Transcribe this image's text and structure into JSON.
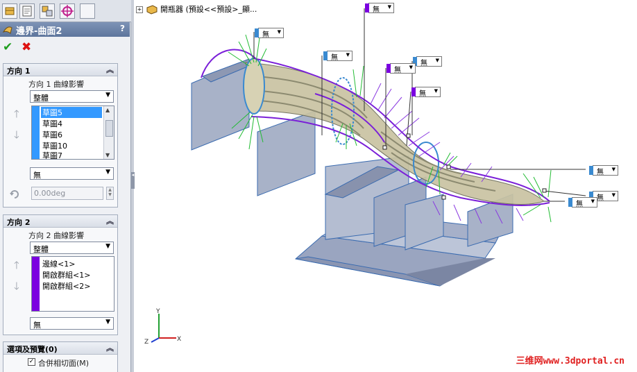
{
  "feature_title": "邊界-曲面2",
  "help_symbol": "?",
  "ok_symbol": "✔",
  "cancel_symbol": "✖",
  "direction1": {
    "header": "方向 1",
    "influence_label": "方向 1 曲線影響",
    "influence_value": "整體",
    "items": [
      "草圖5",
      "草圖4",
      "草圖6",
      "草圖10",
      "草圖7"
    ],
    "tangency_value": "無",
    "angle_value": "0.00deg"
  },
  "direction2": {
    "header": "方向 2",
    "influence_label": "方向 2 曲線影響",
    "influence_value": "整體",
    "items": [
      "邊線<1>",
      "開啟群組<1>",
      "開啟群組<2>"
    ],
    "tangency_value": "無"
  },
  "options": {
    "header": "選項及預覽(0)",
    "merge_label": "合併相切面(M)",
    "merge_checked": true
  },
  "tree": {
    "text": "開瓶器 (預設<<預設>_顯..."
  },
  "callout_value": "無",
  "axes": {
    "x": "X",
    "y": "Y",
    "z": "Z"
  },
  "watermark": "三维网www.3dportal.cn",
  "colors": {
    "direction1_accent": "#3399ff",
    "direction2_accent": "#7b00e0",
    "model_gray": "#a9b3c8",
    "curve_purple": "#7a1fd8",
    "comb_green": "#22bb33"
  }
}
